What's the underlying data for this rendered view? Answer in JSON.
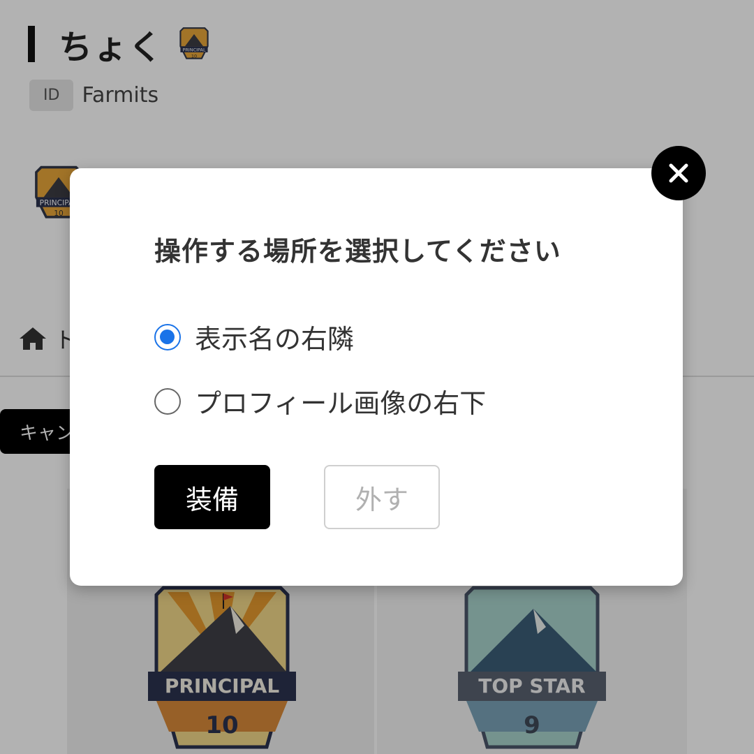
{
  "header": {
    "title": "ちょく",
    "id_label": "ID",
    "id_value": "Farmits"
  },
  "nav": {
    "home_icon": "home-icon",
    "home_label": "ト"
  },
  "toolbar": {
    "cancel_label": "キャン"
  },
  "badges": {
    "principal": {
      "label": "PRINCIPAL",
      "level": "10"
    },
    "top_star": {
      "label": "TOP STAR",
      "level": "9"
    }
  },
  "modal": {
    "title": "操作する場所を選択してください",
    "options": [
      {
        "label": "表示名の右隣",
        "selected": true
      },
      {
        "label": "プロフィール画像の右下",
        "selected": false
      }
    ],
    "equip_label": "装備",
    "remove_label": "外す",
    "close_icon": "close-icon"
  },
  "colors": {
    "accent": "#1a73e8",
    "overlay": "rgba(0,0,0,0.3)"
  }
}
